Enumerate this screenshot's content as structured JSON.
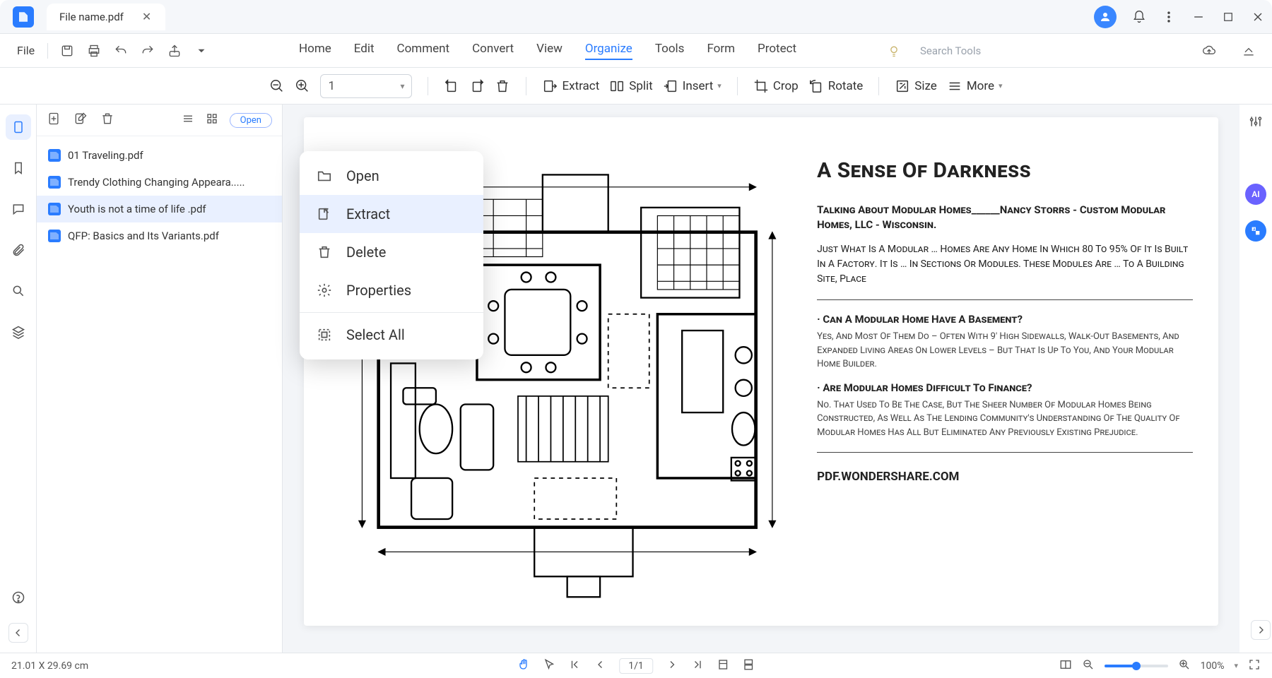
{
  "titlebar": {
    "tab_name": "File name.pdf"
  },
  "menubar": {
    "file": "File",
    "tabs": [
      "Home",
      "Edit",
      "Comment",
      "Convert",
      "View",
      "Organize",
      "Tools",
      "Form",
      "Protect"
    ],
    "active_tab": "Organize",
    "search_placeholder": "Search Tools"
  },
  "toolbar": {
    "page_value": "1",
    "extract": "Extract",
    "split": "Split",
    "insert": "Insert",
    "crop": "Crop",
    "rotate": "Rotate",
    "size": "Size",
    "more": "More"
  },
  "sidebar": {
    "open_chip": "Open",
    "files": [
      "01 Traveling.pdf",
      "Trendy Clothing Changing Appeara.....",
      "Youth is not a time of life .pdf",
      "QFP: Basics and Its Variants.pdf"
    ],
    "selected_index": 2
  },
  "context_menu": {
    "items": [
      "Open",
      "Extract",
      "Delete",
      "Properties",
      "Select All"
    ],
    "hover_index": 1
  },
  "document": {
    "title": "A Sense Of Darkness",
    "subtitle": "Talking About Modular Homes______Nancy Storrs - Custom Modular Homes, LLC - Wisconsin.",
    "intro": "Just What Is A Modular … Homes Are Any Home In Which 80 To 95% Of It Is Built In A Factory. It Is … In Sections Or Modules. These Modules Are … To A Building Site, Place",
    "q1": "· Can A Modular Home Have A Basement?",
    "a1": "Yes, And Most Of Them Do – Often With 9' High Sidewalls, Walk-Out Basements, And Expanded Living Areas On Lower Levels – But That Is Up To You, And Your Modular Home Builder.",
    "q2": "· Are Modular Homes Difficult To Finance?",
    "a2": "No. That Used To Be The Case, But The Sheer Number Of Modular Homes Being Constructed, As Well As The Lending Community's Understanding Of The Quality Of Modular Homes Has All But Eliminated Any Previously Existing Prejudice.",
    "footer": "PDF.WONDERSHARE.COM"
  },
  "statusbar": {
    "dims": "21.01 X 29.69 cm",
    "page_indicator": "1/1",
    "zoom": "100%"
  }
}
